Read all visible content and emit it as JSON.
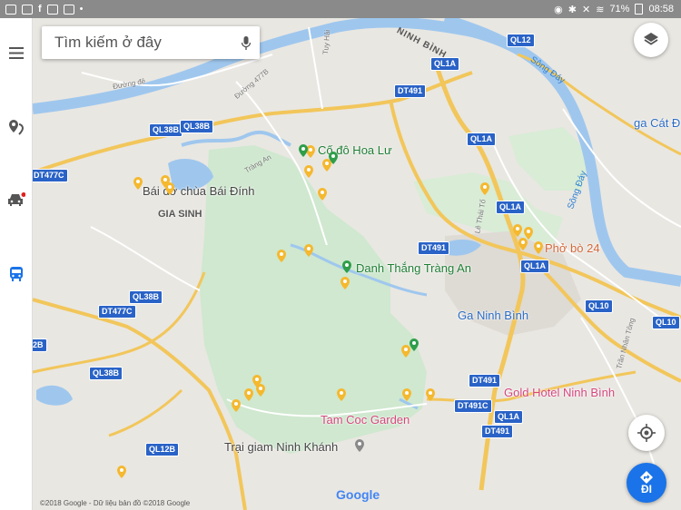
{
  "status_bar": {
    "battery": "71%",
    "time": "08:58"
  },
  "search": {
    "placeholder": "Tìm kiếm ở đây"
  },
  "go_button": {
    "label": "ĐI"
  },
  "map": {
    "labels": {
      "co_do_hoa_lu": "Cố đô Hoa Lư",
      "bai_dinh": "Bái đờ chùa Bái Đính",
      "gia_sinh": "GIA SINH",
      "trang_an": "Danh Thắng Tràng An",
      "pho_bo": "Phở bò 24",
      "ga_ninh_binh": "Ga Ninh Bình",
      "gold_hotel": "Gold Hotel Ninh Bình",
      "tam_coc_garden": "Tam Coc Garden",
      "trai_giam": "Trại giam Ninh Khánh",
      "ga_cat_dang": "ga Cát Đ",
      "ninh_binh_city": "NINH BÌNH",
      "song_day_1": "Sông Đáy",
      "song_day_2": "Sông Đáy",
      "road_477b": "Đường 477B",
      "road_trang_an": "Tràng An",
      "road_le_thai_to": "Lê Thái Tổ",
      "road_tran_nhan_tong": "Trần Nhân Tông",
      "road_tuy_hai": "Tuy Hải",
      "road_duong_do": "Đường đê"
    },
    "shields": {
      "ql12": "QL12",
      "ql1a_1": "QL1A",
      "dt491_1": "DT491",
      "ql1a_2": "QL1A",
      "ql38b_1": "QL38B",
      "ql38b_2": "QL38B",
      "dt477c_1": "DT477C",
      "ql1a_3": "QL1A",
      "dt491_2": "DT491",
      "ql1a_4": "QL1A",
      "ql38b_3": "QL38B",
      "dt477c_2": "DT477C",
      "ql10_1": "QL10",
      "ql10_2": "QL10",
      "b_edge": "2B",
      "ql38b_4": "QL38B",
      "dt491_3": "DT491",
      "dt491c": "DT491C",
      "ql1a_5": "QL1A",
      "dt491_4": "DT491",
      "ql12b": "QL12B"
    }
  },
  "attribution": {
    "copyright": "©2018 Google - Dữ liệu bản đồ ©2018 Google",
    "logo": "Google"
  },
  "colors": {
    "park": "#cfe8cf",
    "land": "#e9e7e2",
    "water": "#9fc7ee",
    "highway": "#f2c65a",
    "accent": "#1a73e8",
    "shield": "#2a63c7"
  },
  "icons": {
    "menu": "menu-icon",
    "places": "explore-pin-icon",
    "driving": "car-icon",
    "transit": "bus-icon",
    "mic": "mic-icon",
    "layers": "layers-icon",
    "location": "my-location-icon",
    "directions": "directions-icon"
  }
}
